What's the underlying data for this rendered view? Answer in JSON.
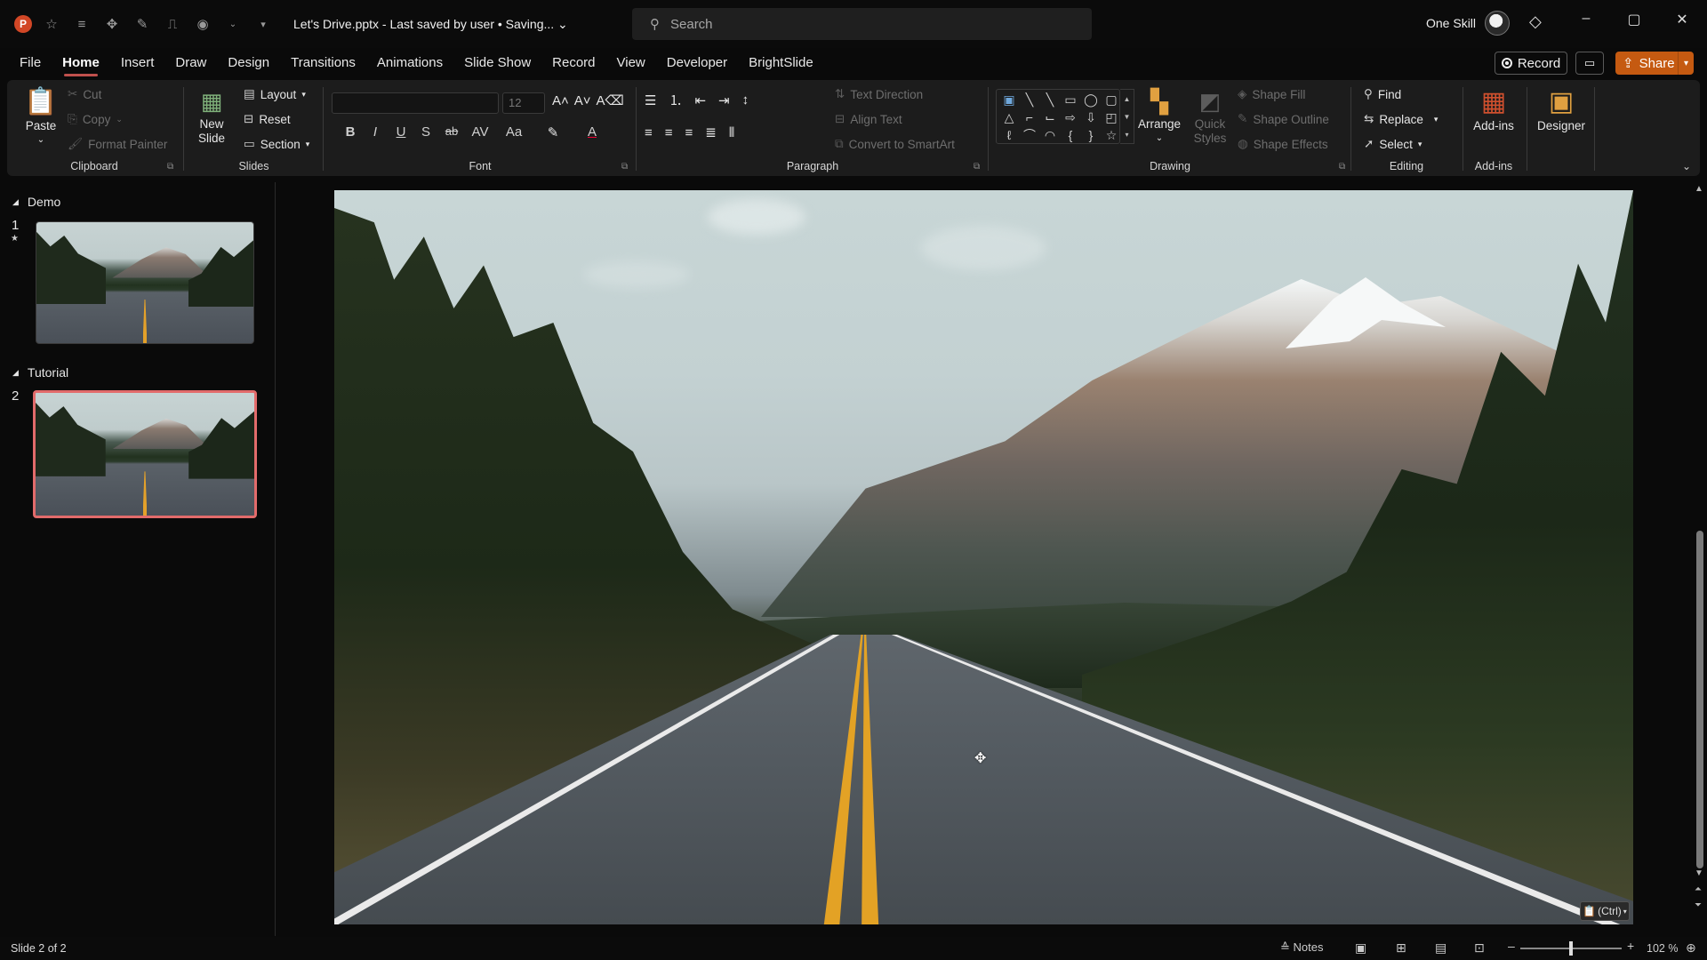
{
  "titlebar": {
    "app_logo": "P",
    "doc_title": "Let's Drive.pptx  -  Last saved by user • Saving... ⌄",
    "search_placeholder": "Search",
    "user_name": "One Skill",
    "window_controls": [
      "–",
      "▢",
      "✕"
    ]
  },
  "tabs": [
    "File",
    "Home",
    "Insert",
    "Draw",
    "Design",
    "Transitions",
    "Animations",
    "Slide Show",
    "Record",
    "View",
    "Developer",
    "BrightSlide"
  ],
  "active_tab": "Home",
  "header_buttons": {
    "record": "Record",
    "share": "Share"
  },
  "ribbon": {
    "clipboard": {
      "label": "Clipboard",
      "paste": "Paste",
      "cut": "Cut",
      "copy": "Copy",
      "format_painter": "Format Painter"
    },
    "slides": {
      "label": "Slides",
      "new_slide": "New Slide",
      "layout": "Layout",
      "reset": "Reset",
      "section": "Section"
    },
    "font": {
      "label": "Font",
      "font_name": "",
      "font_size": "12",
      "buttons": [
        "B",
        "I",
        "U",
        "S",
        "ab",
        "AV",
        "Aa",
        "A"
      ]
    },
    "paragraph": {
      "label": "Paragraph",
      "text_direction": "Text Direction",
      "align_text": "Align Text",
      "convert_smartart": "Convert to SmartArt"
    },
    "drawing": {
      "label": "Drawing",
      "arrange": "Arrange",
      "quick_styles": "Quick Styles",
      "shape_fill": "Shape Fill",
      "shape_outline": "Shape Outline",
      "shape_effects": "Shape Effects"
    },
    "editing": {
      "label": "Editing",
      "find": "Find",
      "replace": "Replace",
      "select": "Select"
    },
    "addins": {
      "label": "Add-ins",
      "addins_btn": "Add-ins",
      "designer": "Designer"
    }
  },
  "thumbnails": {
    "sections": [
      {
        "name": "Demo",
        "slides": [
          {
            "number": "1",
            "has_animation": true
          }
        ]
      },
      {
        "name": "Tutorial",
        "slides": [
          {
            "number": "2",
            "has_animation": false
          }
        ]
      }
    ],
    "selected_slide": "2"
  },
  "canvas": {
    "paste_options": "(Ctrl)"
  },
  "statusbar": {
    "slide_indicator": "Slide 2 of 2",
    "notes": "Notes",
    "zoom": "102 %",
    "zoom_level_percent": 102
  },
  "colors": {
    "accent": "#c0504d",
    "share": "#c55a11",
    "app": "#d24726"
  }
}
